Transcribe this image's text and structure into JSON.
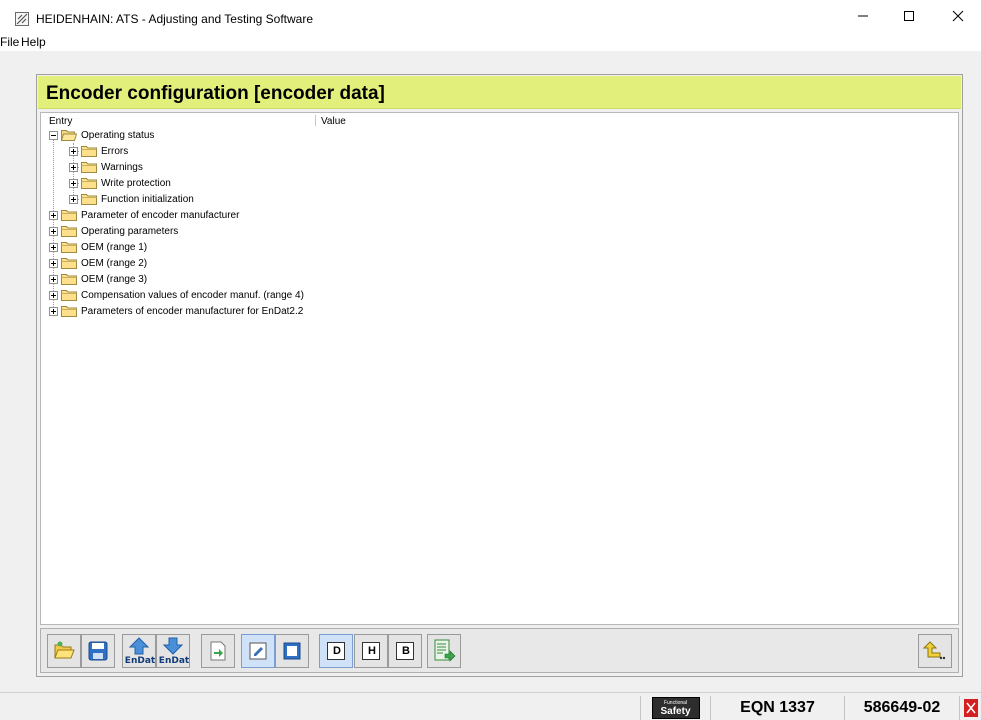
{
  "window": {
    "title": "HEIDENHAIN: ATS - Adjusting and Testing Software",
    "icons": {
      "app": "heidenhain-app-icon",
      "minimize": "minimize-icon",
      "maximize": "maximize-icon",
      "close": "close-icon"
    }
  },
  "menu": {
    "items": [
      "File",
      "Help"
    ]
  },
  "panel": {
    "title": "Encoder configuration [encoder data]",
    "header_color": "#e2f07b",
    "columns": {
      "entry": "Entry",
      "value": "Value"
    }
  },
  "tree": {
    "items": [
      {
        "label": "Operating status",
        "level": 0,
        "expanded": true
      },
      {
        "label": "Errors",
        "level": 1,
        "expanded": false
      },
      {
        "label": "Warnings",
        "level": 1,
        "expanded": false
      },
      {
        "label": "Write protection",
        "level": 1,
        "expanded": false
      },
      {
        "label": "Function initialization",
        "level": 1,
        "expanded": false
      },
      {
        "label": "Parameter of encoder manufacturer",
        "level": 0,
        "expanded": false
      },
      {
        "label": "Operating parameters",
        "level": 0,
        "expanded": false
      },
      {
        "label": "OEM (range 1)",
        "level": 0,
        "expanded": false
      },
      {
        "label": "OEM (range 2)",
        "level": 0,
        "expanded": false
      },
      {
        "label": "OEM (range 3)",
        "level": 0,
        "expanded": false
      },
      {
        "label": "Compensation values of encoder manuf. (range 4)",
        "level": 0,
        "expanded": false
      },
      {
        "label": "Parameters of encoder manufacturer for EnDat2.2",
        "level": 0,
        "expanded": false
      }
    ]
  },
  "toolbar": {
    "buttons": [
      {
        "icon": "open-folder-icon"
      },
      {
        "icon": "save-icon"
      },
      {
        "icon": "upload-endat-icon",
        "label": "EnDat"
      },
      {
        "icon": "download-endat-icon",
        "label": "EnDat"
      },
      {
        "icon": "import-icon"
      },
      {
        "icon": "edit-icon",
        "pressed": true
      },
      {
        "icon": "page-icon"
      },
      {
        "icon": "decimal-format-icon",
        "label": "D",
        "pressed": true
      },
      {
        "icon": "hex-format-icon",
        "label": "H"
      },
      {
        "icon": "binary-format-icon",
        "label": "B"
      },
      {
        "icon": "export-list-icon"
      },
      {
        "icon": "back-icon"
      }
    ]
  },
  "status": {
    "safety_top": "Functional",
    "safety_bottom": "Safety",
    "model": "EQN 1337",
    "id": "586649-02",
    "alert_icon": "alert-icon",
    "alert_color": "#d42020"
  }
}
